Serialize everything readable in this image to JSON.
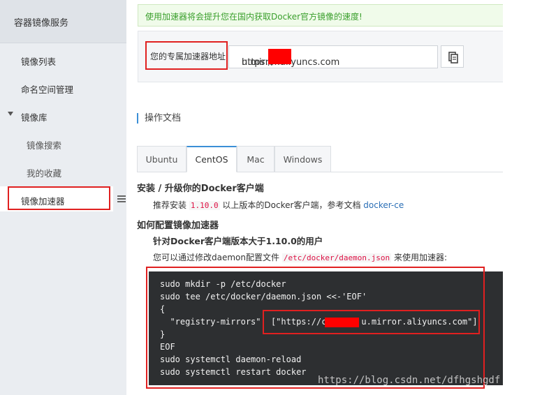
{
  "sidebar": {
    "title": "容器镜像服务",
    "items": [
      {
        "label": "镜像列表"
      },
      {
        "label": "命名空间管理"
      },
      {
        "label": "镜像库"
      },
      {
        "label": "镜像搜索"
      },
      {
        "label": "我的收藏"
      },
      {
        "label": "镜像加速器"
      }
    ]
  },
  "notice": {
    "text": "使用加速器将会提升您在国内获取Docker官方镜像的速度!"
  },
  "accelerator": {
    "label": "您的专属加速器地址",
    "url_prefix": "https://",
    "url_suffix": "u.mirror.aliyuncs.com"
  },
  "docs": {
    "title": "操作文档",
    "tabs": [
      "Ubuntu",
      "CentOS",
      "Mac",
      "Windows"
    ],
    "active_tab": "CentOS"
  },
  "content": {
    "install_heading": "安装 / 升级你的Docker客户端",
    "install_text_before": "推荐安装",
    "install_version": "1.10.0",
    "install_text_after": "以上版本的Docker客户端，参考文档",
    "install_link": "docker-ce",
    "config_heading": "如何配置镜像加速器",
    "version_heading": "针对Docker客户端版本大于1.10.0的用户",
    "modify_text_before": "您可以通过修改daemon配置文件",
    "modify_file": "/etc/docker/daemon.json",
    "modify_text_after": "来使用加速器:"
  },
  "code": {
    "lines": [
      "sudo mkdir -p /etc/docker",
      "sudo tee /etc/docker/daemon.json <<-'EOF'",
      "{",
      "  \"registry-mirrors\": [\"https://c",
      "}",
      "EOF",
      "sudo systemctl daemon-reload",
      "sudo systemctl restart docker"
    ],
    "mirror_line_suffix": "u.mirror.aliyuncs.com\"]"
  },
  "watermark": {
    "text": "https://blog.csdn.net/dfhgshgdf"
  }
}
